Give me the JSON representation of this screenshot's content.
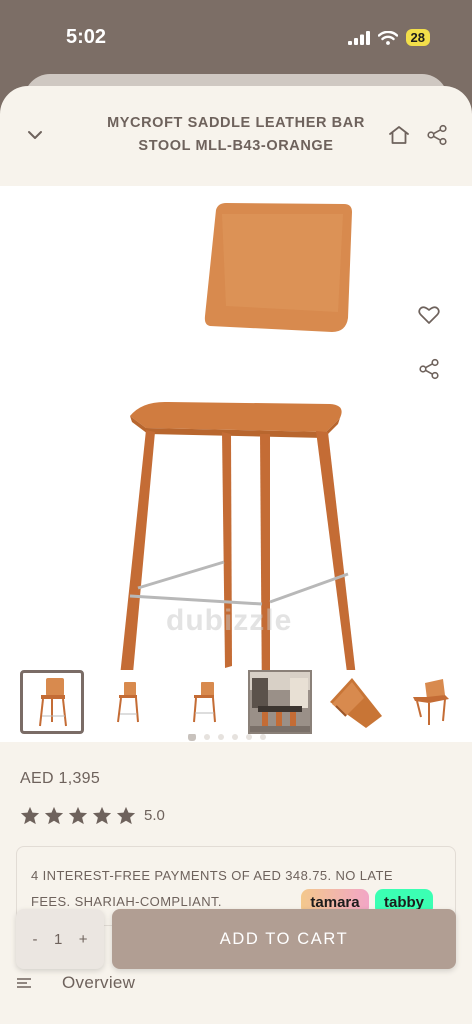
{
  "status_bar": {
    "time": "5:02",
    "battery": "28"
  },
  "header": {
    "title": "MYCROFT SADDLE LEATHER BAR STOOL MLL-B43-ORANGE"
  },
  "gallery": {
    "watermark": "dubizzle",
    "total_images": 6,
    "active_index": 0
  },
  "product": {
    "price": "AED 1,395",
    "rating": "5.0",
    "stars": 5
  },
  "installments": {
    "text": "4 INTEREST-FREE PAYMENTS OF AED 348.75. NO LATE FEES. SHARIAH-COMPLIANT.",
    "providers": [
      "tamara",
      "tabby"
    ]
  },
  "cart": {
    "qty_minus": "-",
    "qty_value": "1",
    "qty_plus": "+",
    "add_label": "ADD TO CART"
  },
  "sections": {
    "overview": "Overview"
  },
  "colors": {
    "accent": "#b19e93",
    "text": "#6e625c",
    "background": "#f7f3ec",
    "tabby": "#3bffb3",
    "tamara": "#f3c88c"
  }
}
